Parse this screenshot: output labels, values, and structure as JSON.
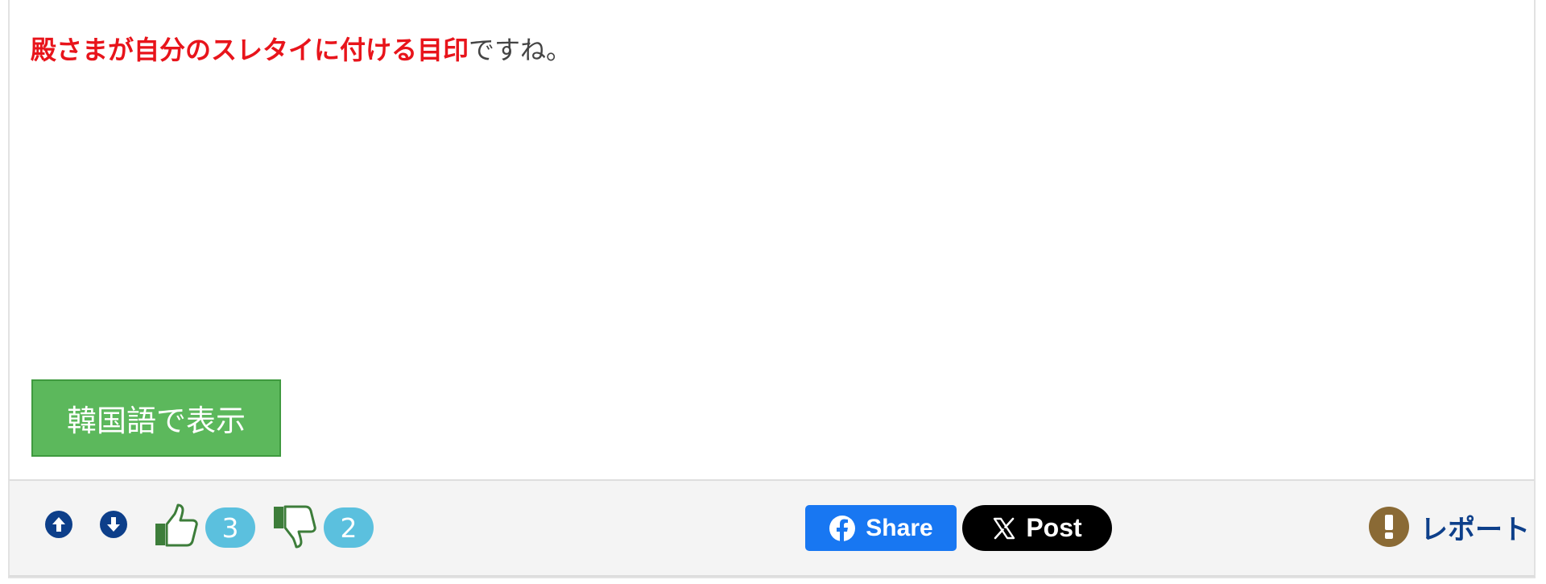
{
  "post": {
    "highlight_text": "殿さまが自分のスレタイに付ける目印",
    "rest_text": "ですね。"
  },
  "translate_button": {
    "label": "韓国語で表示"
  },
  "footer": {
    "up_icon": "arrow-up-circle-icon",
    "down_icon": "arrow-down-circle-icon",
    "like_icon": "thumbs-up-icon",
    "like_count": "3",
    "dislike_icon": "thumbs-down-icon",
    "dislike_count": "2",
    "facebook_share_label": "Share",
    "x_post_label": "Post",
    "report_icon": "exclamation-circle-icon",
    "report_label": "レポート"
  },
  "colors": {
    "highlight": "#e8141b",
    "body_text": "#444444",
    "translate_button_bg": "#5cb85c",
    "badge_bg": "#5bc0de",
    "nav_blue": "#0d3f8a",
    "thumb_green": "#3d7d3a",
    "facebook_blue": "#1877f2",
    "x_black": "#000000",
    "report_brown": "#8a6a35"
  }
}
